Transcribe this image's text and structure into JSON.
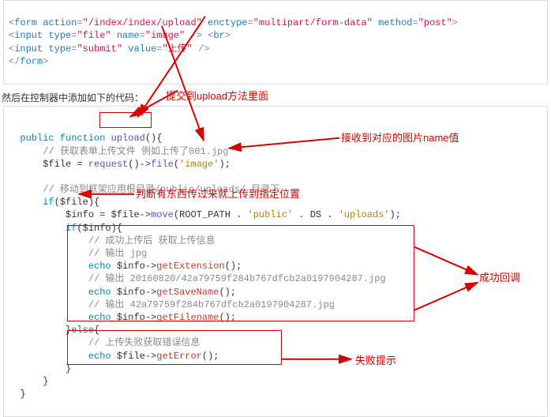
{
  "top_form": {
    "line1_pre": "<",
    "form_tag": "form",
    "action_attr": "action",
    "action_val": "\"/index/index/upload\"",
    "enctype_attr": "enctype",
    "enctype_val": "\"multipart/form-data\"",
    "method_attr": "method",
    "method_val": "\"post\"",
    "gt": ">",
    "input_tag": "input",
    "type_attr": "type",
    "file_val": "\"file\"",
    "name_attr": "name",
    "image_val": "\"image\"",
    "slashgt": " />",
    "br_tag": "br",
    "submit_val": "\"submit\"",
    "value_attr": "value",
    "upload_val": "\"上传\"",
    "form_close": "form"
  },
  "desc": "然后在控制器中添加如下的代码：",
  "php": {
    "public": "public",
    "function": "function",
    "upload": "upload",
    "parens": "()",
    "brace_o": "{",
    "brace_c": "}",
    "c1": "// 获取表单上传文件 例如上传了001.jpg",
    "var_file": "$file",
    "eq": " = ",
    "request": "request",
    "arrow": "->",
    "file_fn": "file",
    "image_arg": "'image'",
    "semi": ";",
    "c2": "// 移动到框架应用根目录/public/uploads/ 目录下",
    "if": "if",
    "info_var": "$info",
    "move": "move",
    "root": "ROOT_PATH",
    "dot": " . ",
    "public_str": "'public'",
    "ds": "DS",
    "uploads_str": "'uploads'",
    "c3": "// 成功上传后 获取上传信息",
    "c4": "// 输出 jpg",
    "echo": "echo",
    "getExtension": "getExtension",
    "c5": "// 输出 20160820/42a79759f284b767dfcb2a0197904287.jpg",
    "getSaveName": "getSaveName",
    "c6": "// 输出 42a79759f284b767dfcb2a0197904287.jpg",
    "getFilename": "getFilename",
    "else": "else",
    "c7": "// 上传失败获取错误信息",
    "getError": "getError"
  },
  "ann": {
    "a1": "提交到upload方法里面",
    "a2": "接收到对应的图片name值",
    "a3": "判断有东西传过来就上传到指定位置",
    "a4": "成功回调",
    "a5": "失败提示"
  }
}
